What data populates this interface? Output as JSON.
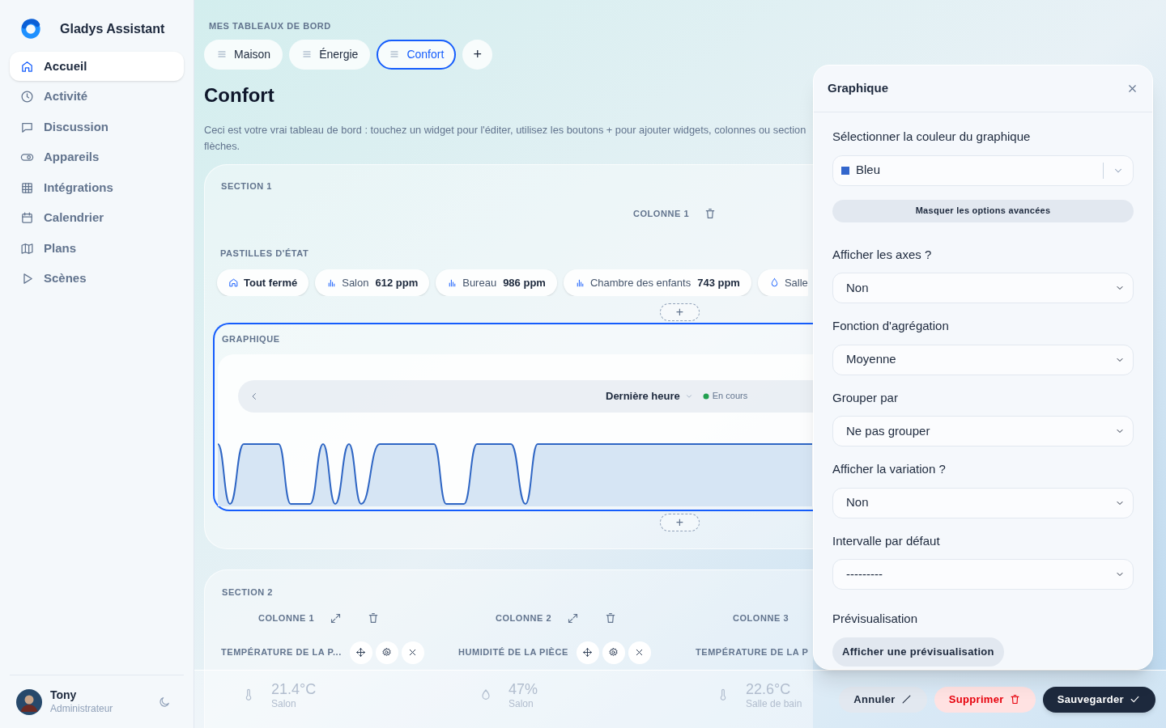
{
  "app": {
    "name": "Gladys Assistant"
  },
  "sidebar": {
    "items": [
      {
        "label": "Accueil",
        "selected": true
      },
      {
        "label": "Activité",
        "selected": false
      },
      {
        "label": "Discussion",
        "selected": false
      },
      {
        "label": "Appareils",
        "selected": false
      },
      {
        "label": "Intégrations",
        "selected": false
      },
      {
        "label": "Calendrier",
        "selected": false
      },
      {
        "label": "Plans",
        "selected": false
      },
      {
        "label": "Scènes",
        "selected": false
      }
    ]
  },
  "user": {
    "name": "Tony",
    "role": "Administrateur"
  },
  "dashboards": {
    "heading": "MES TABLEAUX DE BORD",
    "tabs": [
      {
        "label": "Maison",
        "selected": false
      },
      {
        "label": "Énergie",
        "selected": false
      },
      {
        "label": "Confort",
        "selected": true
      }
    ],
    "add_label": "+"
  },
  "page": {
    "title": "Confort",
    "description_lines": [
      "Ceci est votre vrai tableau de bord : touchez un widget pour l'éditer, utilisez les boutons + pour ajouter widgets, colonnes ou section",
      "flèches."
    ]
  },
  "section_1": {
    "title": "SECTION 1",
    "column": "COLONNE 1",
    "badges_heading": "PASTILLES D'ÉTAT",
    "badges": [
      {
        "kind": "status",
        "label": "Tout fermé"
      },
      {
        "kind": "sensor",
        "label": "Salon",
        "value": "612 ppm"
      },
      {
        "kind": "sensor",
        "label": "Bureau",
        "value": "986 ppm"
      },
      {
        "kind": "sensor",
        "label": "Chambre des enfants",
        "value": "743 ppm"
      },
      {
        "kind": "humidity",
        "label": "Salle"
      }
    ],
    "add_label": "+",
    "chart_widget": {
      "title": "GRAPHIQUE",
      "range": "Dernière heure",
      "status": "En cours",
      "selected": true
    },
    "add_label_2": "+"
  },
  "section_2": {
    "title": "SECTION 2",
    "columns": [
      {
        "label": "COLONNE 1",
        "widget": "TEMPÉRATURE DE LA P...",
        "tile": {
          "kind": "temperature",
          "value": "21.4°C",
          "label": "Salon"
        }
      },
      {
        "label": "COLONNE 2",
        "widget": "HUMIDITÉ DE LA PIÈCE",
        "tile": {
          "kind": "humidity",
          "value": "47%",
          "label": "Salon"
        }
      },
      {
        "label": "COLONNE 3",
        "widget": "TEMPÉRATURE DE LA P",
        "tile": {
          "kind": "temperature",
          "value": "22.6°C",
          "label": "Salle de bain"
        }
      }
    ]
  },
  "panel": {
    "title": "Graphique",
    "color_label": "Sélectionner la couleur du graphique",
    "color": {
      "value": "Bleu",
      "color": "#3366cc"
    },
    "advanced_button": "Masquer les options avancées",
    "fields": [
      {
        "label": "Afficher les axes ?",
        "value": "Non"
      },
      {
        "label": "Fonction d'agrégation",
        "value": "Moyenne"
      },
      {
        "label": "Grouper par",
        "value": "Ne pas grouper"
      },
      {
        "label": "Afficher la variation ?",
        "value": "Non"
      },
      {
        "label": "Intervalle par défaut",
        "value": "---------"
      }
    ],
    "preview_label": "Prévisualisation",
    "preview_button": "Afficher une prévisualisation"
  },
  "footer": {
    "buttons": [
      {
        "kind": "cancel",
        "label": "Annuler"
      },
      {
        "kind": "delete",
        "label": "Supprimer"
      },
      {
        "kind": "save",
        "label": "Sauvegarder"
      }
    ]
  }
}
